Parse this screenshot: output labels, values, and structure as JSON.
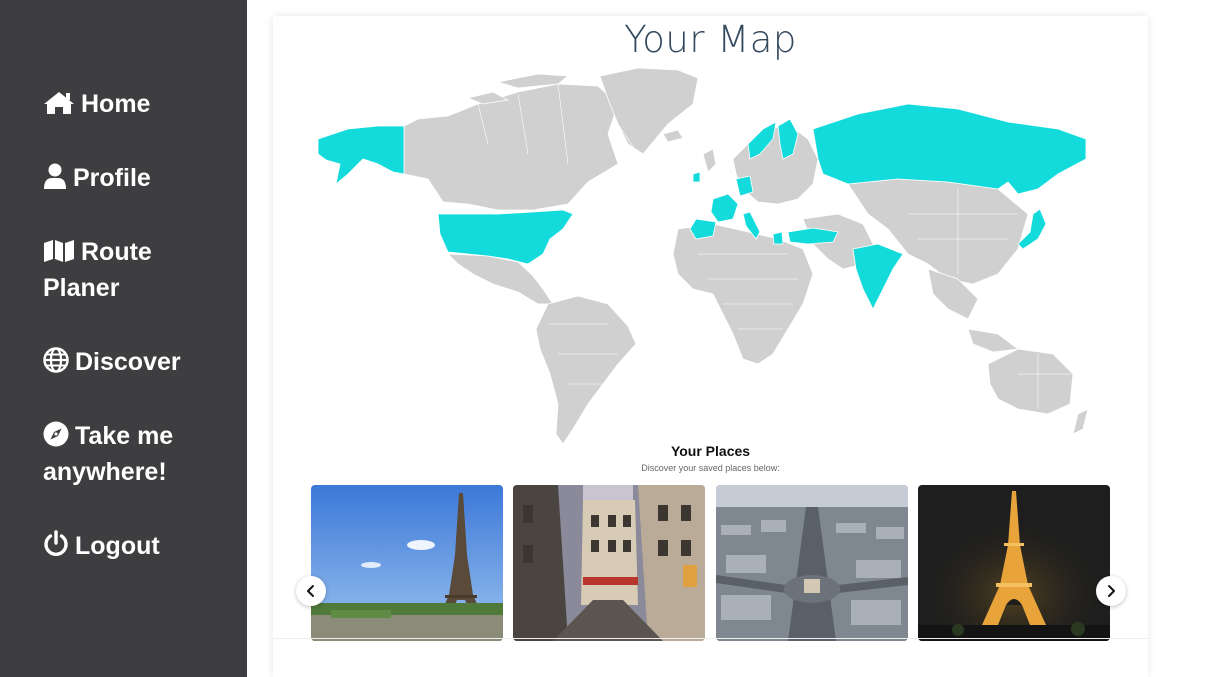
{
  "sidebar": {
    "items": [
      {
        "label": "Home",
        "icon": "home-icon"
      },
      {
        "label": "Profile",
        "icon": "user-icon"
      },
      {
        "label": "Route Planer",
        "icon": "map-icon"
      },
      {
        "label": "Discover",
        "icon": "globe-icon"
      },
      {
        "label": "Take me anywhere!",
        "icon": "compass-icon"
      },
      {
        "label": "Logout",
        "icon": "power-icon"
      }
    ]
  },
  "main": {
    "title": "Your Map",
    "map": {
      "visited_countries": [
        "Alaska",
        "United States",
        "Russia",
        "India",
        "Turkey",
        "Japan",
        "France",
        "Germany",
        "Italy",
        "Spain",
        "Portugal",
        "Greece",
        "Ireland",
        "Norway",
        "Finland",
        "Croatia",
        "Austria",
        "Switzerland"
      ],
      "visited_color": "#14dbdb",
      "land_color": "#d0d0d0",
      "border_color": "#ffffff"
    },
    "places": {
      "title": "Your Places",
      "subtitle": "Discover your saved places below:",
      "cards": [
        {
          "subject": "eiffel-tower-day"
        },
        {
          "subject": "paris-street"
        },
        {
          "subject": "arc-de-triomphe-aerial"
        },
        {
          "subject": "eiffel-tower-night"
        }
      ]
    }
  },
  "colors": {
    "sidebar_bg": "#3e3e40",
    "title_color": "#34495e",
    "accent": "#14dbdb"
  }
}
